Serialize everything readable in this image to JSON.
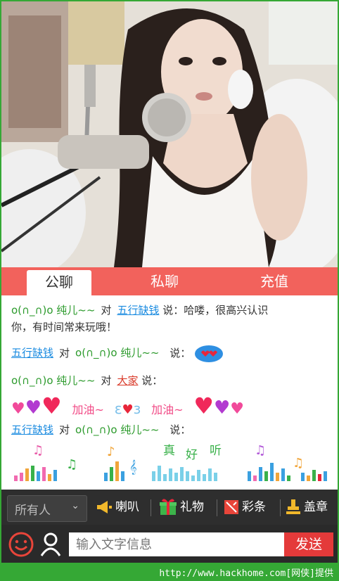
{
  "tabs": [
    {
      "label": "公聊",
      "active": true
    },
    {
      "label": "私聊",
      "active": false
    },
    {
      "label": "充值",
      "active": false
    }
  ],
  "chat": {
    "msg1": {
      "from": "o(∩_∩)o 纯儿~~",
      "to_word": "对",
      "to": "五行缺钱",
      "say": "说：",
      "text1": "哈喽，很高兴认识",
      "text2": "你，有时间常来玩哦！"
    },
    "msg2": {
      "from": "五行缺钱",
      "to_word": "对",
      "to": "o(∩_∩)o 纯儿~~",
      "say": "说："
    },
    "msg3": {
      "from": "o(∩_∩)o 纯儿~~",
      "to_word": "对",
      "to": "大家",
      "say": "说：",
      "cheer1": "加油~",
      "cheer2": "加油~"
    },
    "msg4": {
      "from": "五行缺钱",
      "to_word": "对",
      "to": "o(∩_∩)o 纯儿~~",
      "say": "说："
    },
    "music_words": [
      "真",
      "好",
      "听"
    ]
  },
  "toolbar": {
    "audience": "所有人",
    "horn": "喇叭",
    "gift": "礼物",
    "ribbon": "彩条",
    "stamp": "盖章"
  },
  "input": {
    "placeholder": "输入文字信息",
    "send": "发送"
  },
  "credit": "http://www.hackhome.com[网侠]提供",
  "colors": {
    "tab_bar": "#f2625c",
    "nick": "#2b9a2b",
    "link": "#1a8be0",
    "send": "#e43a3a",
    "frame": "#35a835"
  }
}
